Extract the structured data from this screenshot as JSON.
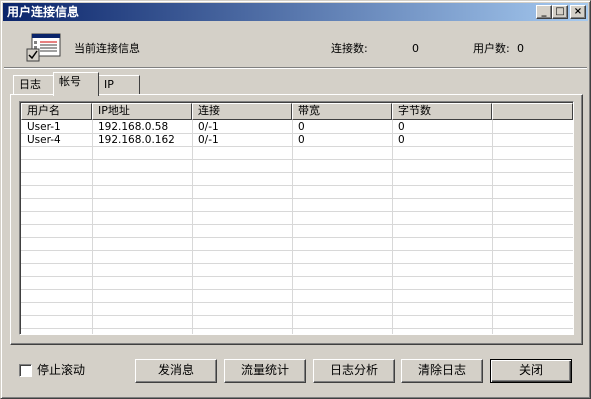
{
  "window": {
    "title": "用户连接信息"
  },
  "title_buttons": {
    "minimize": "_",
    "maximize": "□",
    "close": "×"
  },
  "header": {
    "label": "当前连接信息",
    "connections_label": "连接数:",
    "connections_value": "0",
    "users_label": "用户数:",
    "users_value": "0"
  },
  "tabs": [
    {
      "label": "日志",
      "active": false
    },
    {
      "label": "帐号",
      "active": true
    },
    {
      "label": "IP",
      "active": false
    }
  ],
  "table": {
    "columns": [
      "用户名",
      "IP地址",
      "连接",
      "带宽",
      "字节数",
      ""
    ],
    "rows": [
      [
        "User-1",
        "192.168.0.58",
        "0/-1",
        "0",
        "0",
        ""
      ],
      [
        "User-4",
        "192.168.0.162",
        "0/-1",
        "0",
        "0",
        ""
      ]
    ]
  },
  "footer": {
    "stop_scroll_label": "停止滚动",
    "stop_scroll_checked": false,
    "buttons": {
      "send_message": "发消息",
      "traffic_stats": "流量统计",
      "log_analysis": "日志分析",
      "clear_log": "清除日志",
      "close": "关闭"
    }
  }
}
